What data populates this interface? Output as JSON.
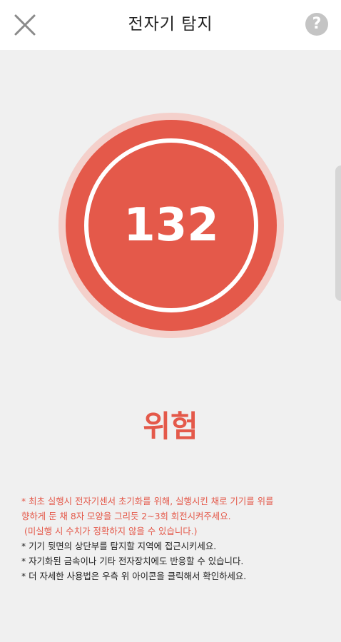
{
  "header": {
    "title": "전자기 탐지",
    "close_icon": "close-icon",
    "help_icon": "help-icon",
    "help_glyph": "?"
  },
  "gauge": {
    "value": "132",
    "color": "#e4594a"
  },
  "status": {
    "label": "위험"
  },
  "instructions": {
    "warning_line1": "* 최초 실행시 전자기센서 초기화를 위해, 실행시킨 채로 기기를 위를",
    "warning_line2": "향하게 둔 채 8자 모양을 그리듯 2~3회 회전시켜주세요.",
    "warning_line3": "(미실행 시 수치가 정확하지 않을 수 있습니다.)",
    "tip1": "* 기기 뒷면의 상단부를 탐지할 지역에 접근시키세요.",
    "tip2": "* 자기화된 금속이나 기타 전자장치에도 반응할 수 있습니다.",
    "tip3": "* 더 자세한 사용법은 우측 위 아이콘을 클릭해서 확인하세요."
  },
  "colors": {
    "accent": "#e4594a",
    "background": "#f0f0f0"
  }
}
